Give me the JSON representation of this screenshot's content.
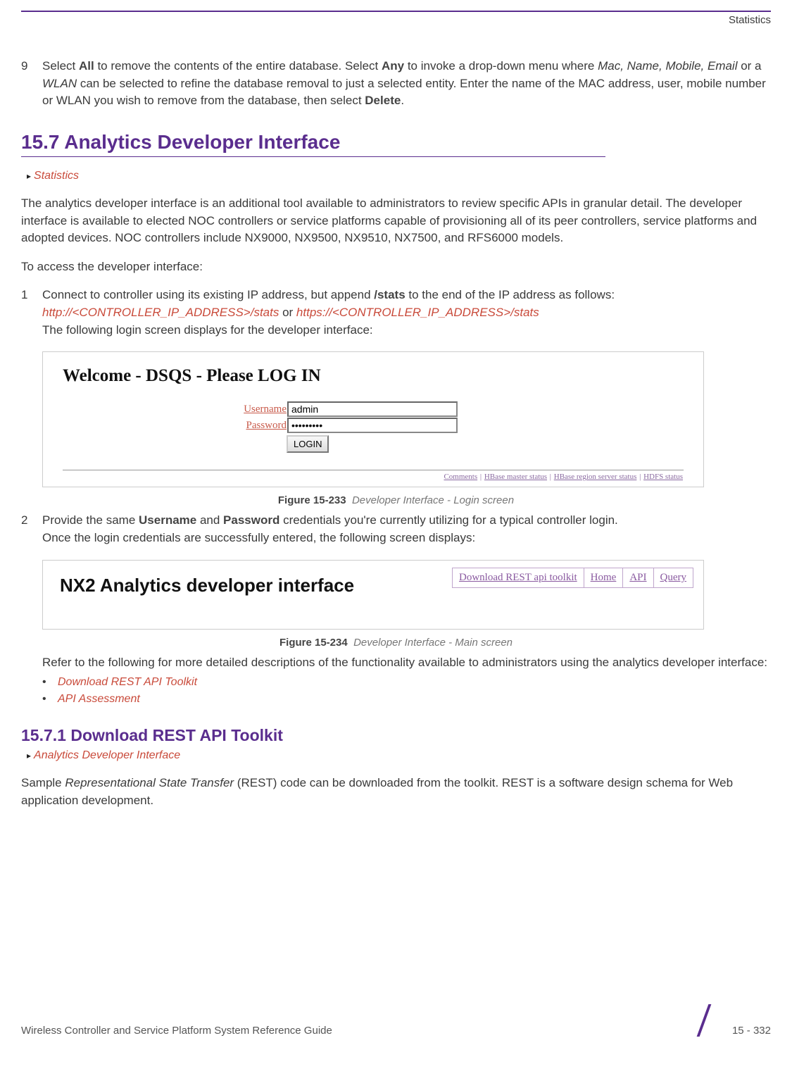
{
  "header": {
    "label": "Statistics"
  },
  "step9": {
    "num": "9",
    "text_parts": {
      "p1": "Select ",
      "all": "All",
      "p2": " to remove the contents of the entire database. Select ",
      "any": "Any",
      "p3": " to invoke a drop-down menu where ",
      "italic1": "Mac, Name, Mobile, Email",
      "p4": " or a ",
      "italic2": "WLAN",
      "p5": " can be selected to refine the database removal to just a selected entity. Enter the name of the MAC address, user, mobile number or WLAN you wish to remove from the database, then select ",
      "delete": "Delete",
      "p6": "."
    }
  },
  "section157": {
    "title": "15.7 Analytics Developer Interface",
    "breadcrumb": "Statistics",
    "para1": "The analytics developer interface is an additional tool available to administrators to review specific APIs in granular detail. The developer interface is available to elected NOC controllers or service platforms capable of provisioning all of its peer controllers, service platforms and adopted devices. NOC controllers include NX9000, NX9500, NX9510, NX7500, and RFS6000 models.",
    "para2": "To access the developer interface:"
  },
  "step1": {
    "num": "1",
    "p1": "Connect to controller using its existing IP address, but append ",
    "stats": "/stats",
    "p2": " to the end of the IP address as follows:",
    "url1": "http://<CONTROLLER_IP_ADDRESS>/stats",
    "or": " or ",
    "url2": "https://<CONTROLLER_IP_ADDRESS>/stats",
    "p3": "The following login screen displays for the developer interface:"
  },
  "login_fig": {
    "title": "Welcome - DSQS - Please LOG IN",
    "username_label": "Username",
    "username_value": "admin",
    "password_label": "Password",
    "password_value": "•••••••••",
    "button": "LOGIN",
    "footer_items": [
      "Comments",
      "HBase master status",
      "HBase region server status",
      "HDFS status"
    ],
    "caption_num": "Figure 15-233",
    "caption_desc": "Developer Interface - Login screen"
  },
  "step2": {
    "num": "2",
    "p1": "Provide the same ",
    "username": "Username",
    "p2": " and ",
    "password": "Password",
    "p3": " credentials you're currently utilizing for a typical controller login.",
    "p4": "Once the login credentials are successfully entered, the following screen displays:"
  },
  "dev_fig": {
    "title": "NX2 Analytics developer interface",
    "nav": [
      "Download REST api toolkit",
      "Home",
      "API",
      "Query"
    ],
    "caption_num": "Figure 15-234",
    "caption_desc": "Developer Interface - Main screen"
  },
  "refer_text": "Refer to the following for more detailed descriptions of the functionality available to administrators using the analytics developer interface:",
  "bullets": [
    "Download REST API Toolkit",
    "API Assessment"
  ],
  "section1571": {
    "title": "15.7.1 Download REST API Toolkit",
    "breadcrumb": "Analytics Developer Interface",
    "para": {
      "p1": "Sample ",
      "italic": "Representational State Transfer",
      "p2": " (REST) code can be downloaded from the toolkit. REST is a software design schema for Web application development."
    }
  },
  "footer": {
    "guide_name": "Wireless Controller and Service Platform System Reference Guide",
    "page_num": "15 - 332"
  }
}
